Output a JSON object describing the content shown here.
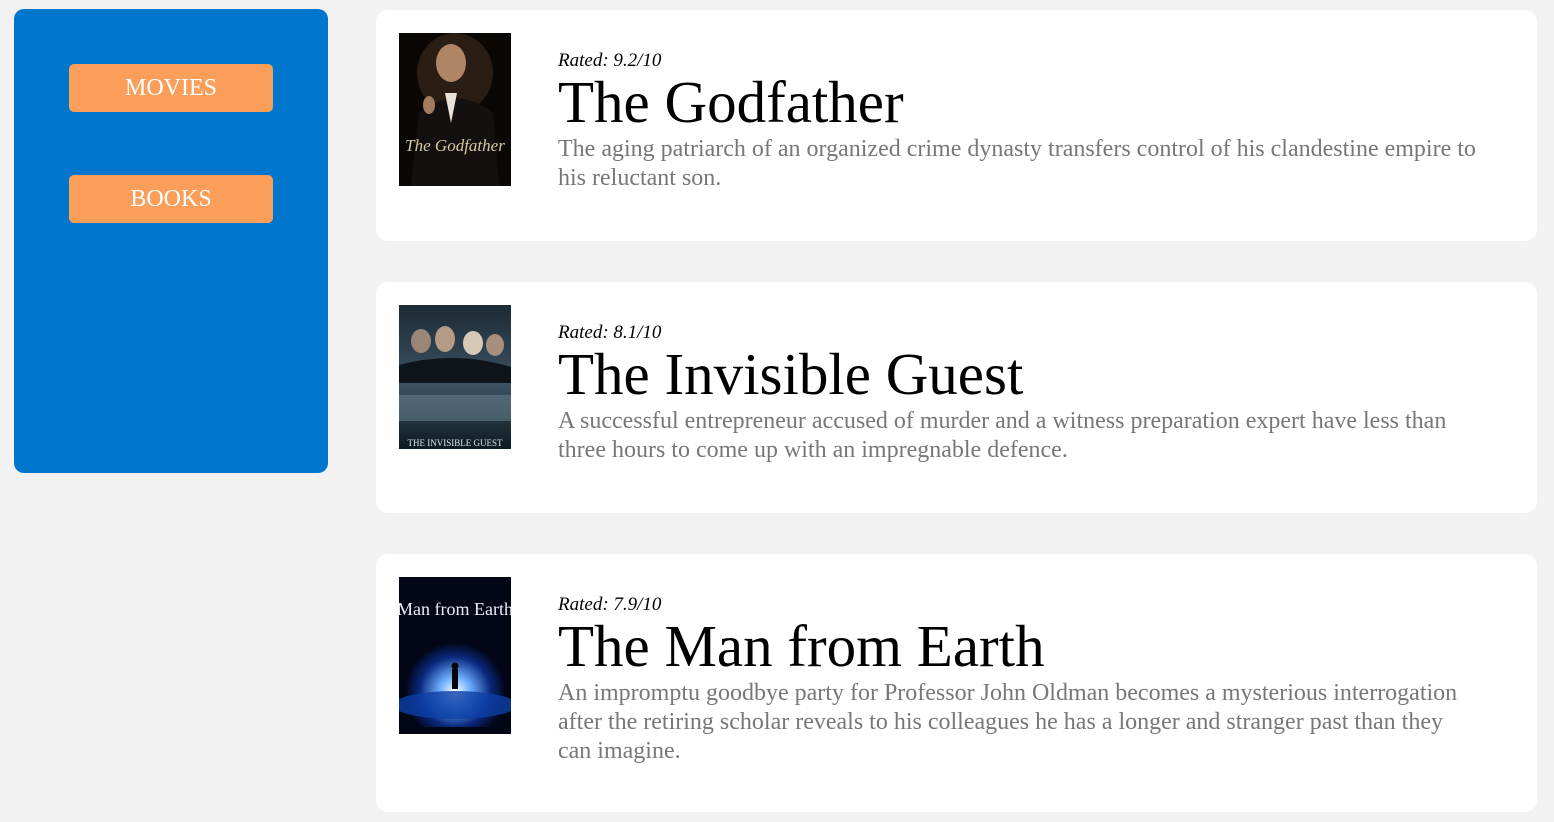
{
  "sidebar": {
    "nav": [
      {
        "label": "MOVIES"
      },
      {
        "label": "BOOKS"
      }
    ]
  },
  "movies": [
    {
      "rated": "Rated: 9.2/10",
      "title": "The Godfather",
      "description": "The aging patriarch of an organized crime dynasty transfers control of his clandestine empire to his reluctant son.",
      "poster_text": "The Godfather"
    },
    {
      "rated": "Rated: 8.1/10",
      "title": "The Invisible Guest",
      "description": "A successful entrepreneur accused of murder and a witness preparation expert have less than three hours to come up with an impregnable defence.",
      "poster_text": "THE INVISIBLE GUEST"
    },
    {
      "rated": "Rated: 7.9/10",
      "title": "The Man from Earth",
      "description": "An impromptu goodbye party for Professor John Oldman becomes a mysterious interrogation after the retiring scholar reveals to his colleagues he has a longer and stranger past than they can imagine.",
      "poster_text": "Man from Earth"
    }
  ],
  "colors": {
    "sidebar": "#0077cc",
    "nav_button": "#fa9e5a",
    "background": "#f2f2f2",
    "description_text": "#777777"
  }
}
